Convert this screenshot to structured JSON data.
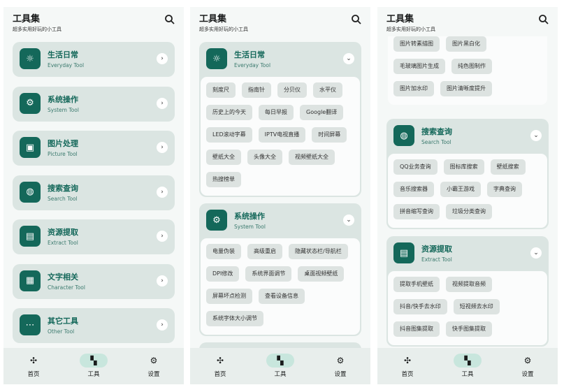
{
  "app": {
    "title": "工具集",
    "subtitle": "超多实用好玩的小工具"
  },
  "nav": [
    {
      "label": "首页",
      "icon": "pinwheel-icon"
    },
    {
      "label": "工具",
      "icon": "grid-icon"
    },
    {
      "label": "设置",
      "icon": "gear-icon"
    }
  ],
  "categories": [
    {
      "title": "生活日常",
      "en": "Everyday Tool",
      "icon": "sun-icon"
    },
    {
      "title": "系统操作",
      "en": "System Tool",
      "icon": "gear-icon"
    },
    {
      "title": "图片处理",
      "en": "Picture Tool",
      "icon": "image-icon"
    },
    {
      "title": "搜索查询",
      "en": "Search Tool",
      "icon": "globe-icon"
    },
    {
      "title": "资源提取",
      "en": "Extract Tool",
      "icon": "archive-icon"
    },
    {
      "title": "文字相关",
      "en": "Character Tool",
      "icon": "document-icon"
    },
    {
      "title": "其它工具",
      "en": "Other Tool",
      "icon": "more-icon"
    }
  ],
  "tools": {
    "everyday": [
      "刻度尺",
      "指南针",
      "分贝仪",
      "水平仪",
      "历史上的今天",
      "每日早报",
      "Google翻译",
      "LED滚动字幕",
      "IPTV电视直播",
      "时间屏幕",
      "壁纸大全",
      "头像大全",
      "视频壁纸大全",
      "热搜榜单"
    ],
    "system": [
      "电量伪装",
      "高级重启",
      "隐藏状态栏/导航栏",
      "DPI修改",
      "系统界面调节",
      "桌面视频壁纸",
      "屏幕坏点检测",
      "查看设备信息",
      "系统字体大小调节"
    ],
    "picture": [
      "图片转素描图",
      "图片黑白化",
      "毛玻璃图片生成",
      "纯色图制作",
      "图片加水印",
      "图片清晰度提升"
    ],
    "search": [
      "QQ业务查询",
      "图标库搜索",
      "壁纸搜索",
      "音乐搜索器",
      "小霸王游戏",
      "字典查询",
      "拼音缩写查询",
      "垃圾分类查询"
    ],
    "extract": [
      "提取手机壁纸",
      "视频提取音频",
      "抖音/快手去水印",
      "短视频去水印",
      "抖音图集提取",
      "快手图集提取"
    ]
  }
}
